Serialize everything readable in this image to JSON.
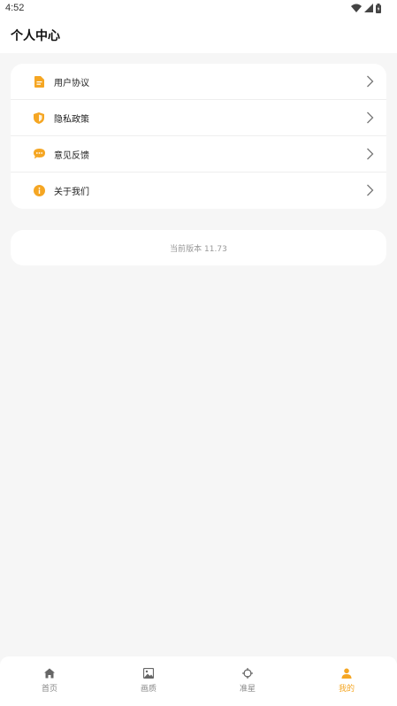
{
  "status": {
    "time": "4:52"
  },
  "header": {
    "title": "个人中心"
  },
  "menu": {
    "items": [
      {
        "label": "用户协议",
        "icon": "document-icon"
      },
      {
        "label": "隐私政策",
        "icon": "shield-icon"
      },
      {
        "label": "意见反馈",
        "icon": "chat-bubble-icon"
      },
      {
        "label": "关于我们",
        "icon": "info-icon"
      }
    ]
  },
  "version": {
    "text": "当前版本 11.73"
  },
  "tabbar": {
    "tabs": [
      {
        "label": "首页",
        "icon": "home-icon"
      },
      {
        "label": "画质",
        "icon": "image-icon"
      },
      {
        "label": "准星",
        "icon": "crosshair-icon"
      },
      {
        "label": "我的",
        "icon": "user-icon"
      }
    ],
    "active": "我的"
  },
  "colors": {
    "accent": "#f5a623",
    "background": "#f6f6f6"
  }
}
